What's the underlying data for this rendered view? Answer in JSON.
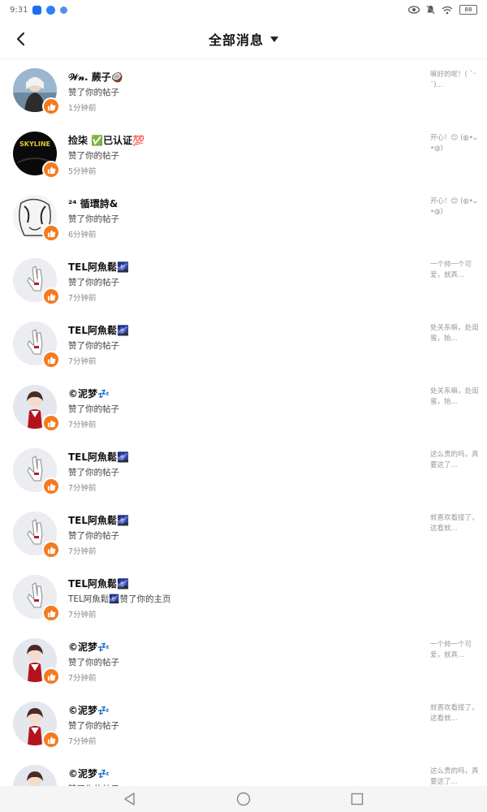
{
  "status_bar": {
    "time": "9:31",
    "battery": "88",
    "icons": [
      "app-icon",
      "app-icon",
      "app-icon"
    ],
    "right_icons": [
      "eye-icon",
      "mute-icon",
      "wifi-icon",
      "battery-icon"
    ]
  },
  "header": {
    "back_icon": "chevron-left-icon",
    "title": "全部消息",
    "dropdown_icon": "caret-down-icon"
  },
  "accent_color": "#f47a1f",
  "notifications": [
    {
      "name": "𝒲𝓃. 蕨子🥥",
      "action": "赞了你的帖子",
      "time": "1分钟前",
      "preview": "嘛好的呢！( ˘ᵕ˘)...",
      "avatar": "photo-girl"
    },
    {
      "name": "捡柒       ✅已认证💯",
      "action": "赞了你的帖子",
      "time": "5分钟前",
      "preview": "开心！😊 (◍•ᴗ•◍)",
      "avatar": "dark-logo"
    },
    {
      "name": "²⁴ 循環詩&",
      "action": "赞了你的帖子",
      "time": "6分钟前",
      "preview": "开心！😊 (◍•ᴗ•◍)",
      "avatar": "sketch"
    },
    {
      "name": "TEL阿魚鬆🌌",
      "action": "赞了你的帖子",
      "time": "7分钟前",
      "preview": "一个帅一个可爱，就真...",
      "avatar": "hand"
    },
    {
      "name": "TEL阿魚鬆🌌",
      "action": "赞了你的帖子",
      "time": "7分钟前",
      "preview": "处关系嘛，处闺蜜，始...",
      "avatar": "hand"
    },
    {
      "name": "©泥梦💤",
      "action": "赞了你的帖子",
      "time": "7分钟前",
      "preview": "处关系嘛，处闺蜜，始...",
      "avatar": "anime"
    },
    {
      "name": "TEL阿魚鬆🌌",
      "action": "赞了你的帖子",
      "time": "7分钟前",
      "preview": "这么贵的吗，真要这了...",
      "avatar": "hand"
    },
    {
      "name": "TEL阿魚鬆🌌",
      "action": "赞了你的帖子",
      "time": "7分钟前",
      "preview": "就喜欢看接了，这看就...",
      "avatar": "hand"
    },
    {
      "name": "TEL阿魚鬆🌌",
      "action": "TEL阿魚鬆🌌赞了你的主页",
      "time": "7分钟前",
      "preview": "",
      "avatar": "hand"
    },
    {
      "name": "©泥梦💤",
      "action": "赞了你的帖子",
      "time": "7分钟前",
      "preview": "一个帅一个可爱，就真...",
      "avatar": "anime"
    },
    {
      "name": "©泥梦💤",
      "action": "赞了你的帖子",
      "time": "7分钟前",
      "preview": "就喜欢看接了，这看就...",
      "avatar": "anime"
    },
    {
      "name": "©泥梦💤",
      "action": "赞了你的帖子",
      "time": "",
      "preview": "这么贵的吗，真要这了...",
      "avatar": "anime"
    }
  ],
  "nav_bar": {
    "buttons": [
      "back-triangle-icon",
      "home-circle-icon",
      "recents-square-icon"
    ]
  }
}
